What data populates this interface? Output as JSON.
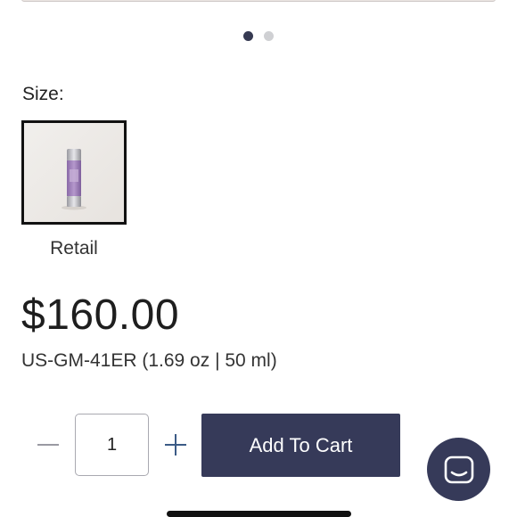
{
  "carousel": {
    "slides": 2,
    "active_index": 0
  },
  "product": {
    "size_label": "Size:",
    "size_options": [
      {
        "label": "Retail",
        "selected": true
      }
    ],
    "price": "$160.00",
    "sku": "US-GM-41ER (1.69 oz | 50 ml)"
  },
  "purchase": {
    "quantity": "1",
    "decrease_icon": "minus-icon",
    "increase_icon": "plus-icon",
    "add_to_cart_label": "Add To Cart"
  },
  "chat": {
    "icon": "chat-icon"
  },
  "colors": {
    "accent": "#363a59",
    "plus_icon": "#3b5b86",
    "minus_icon": "#9a9aa2",
    "text": "#222222",
    "dot_inactive": "#cfd0d3"
  }
}
